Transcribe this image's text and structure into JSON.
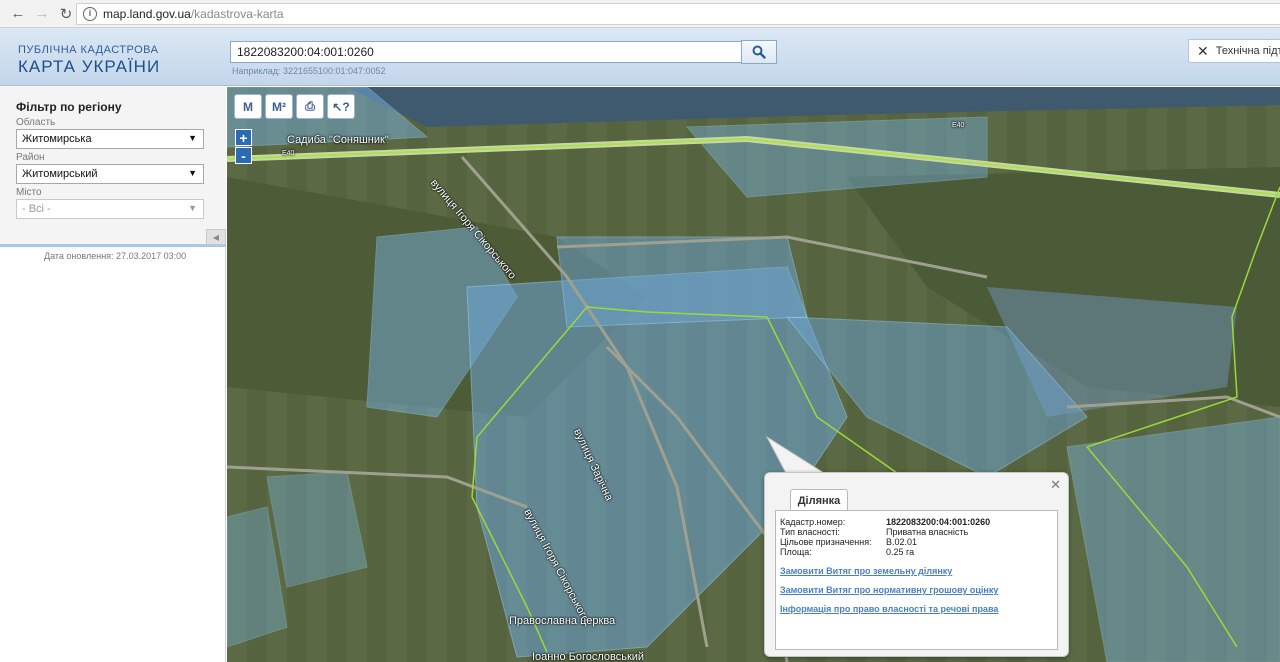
{
  "browser": {
    "url_host": "map.land.gov.ua",
    "url_path": "/kadastrova-karta"
  },
  "header": {
    "logo_line1": "ПУБЛІЧНА КАДАСТРОВА",
    "logo_line2": "КАРТА УКРАЇНИ",
    "search_value": "1822083200:04:001:0260",
    "search_example": "Наприклад: 3221655100:01:047:0052",
    "support_label": "Технічна підт"
  },
  "sidebar": {
    "filter_title": "Фільтр по регіону",
    "region_label": "Область",
    "region_value": "Житомирська",
    "district_label": "Район",
    "district_value": "Житомирський",
    "city_label": "Місто",
    "city_value": "- Всі -",
    "update_date": "Дата оновлення: 27.03.2017 03:00"
  },
  "map": {
    "tools": [
      "M",
      "M²",
      "print",
      "info"
    ],
    "zoom_in": "+",
    "zoom_out": "-",
    "labels": {
      "sadyba": "Садиба \"Соняшник\"",
      "street1": "вулиця Ігоря Сікорського",
      "street2": "вулиця Зарічна",
      "street3": "вулиця Ігоря Сікорського",
      "church": "Православна церква",
      "church2": "Іоанно Богословський",
      "road": "E40"
    }
  },
  "popup": {
    "tab_label": "Ділянка",
    "rows": [
      {
        "key": "Кадастр.номер:",
        "value": "1822083200:04:001:0260"
      },
      {
        "key": "Тип власності:",
        "value": "Приватна власність"
      },
      {
        "key": "Цільове призначення:",
        "value": "В.02.01"
      },
      {
        "key": "Площа:",
        "value": "0.25 га"
      }
    ],
    "links": [
      "Замовити Витяг про земельну ділянку",
      "Замовити Витяг про нормативну грошову оцінку",
      "Інформація про право власності та речові права"
    ]
  },
  "colors": {
    "parcel_border": "#9fd4ff",
    "parcel_fill": "#7ab8ee",
    "boundary": "#9bd93a",
    "accent": "#2b6bb6"
  }
}
